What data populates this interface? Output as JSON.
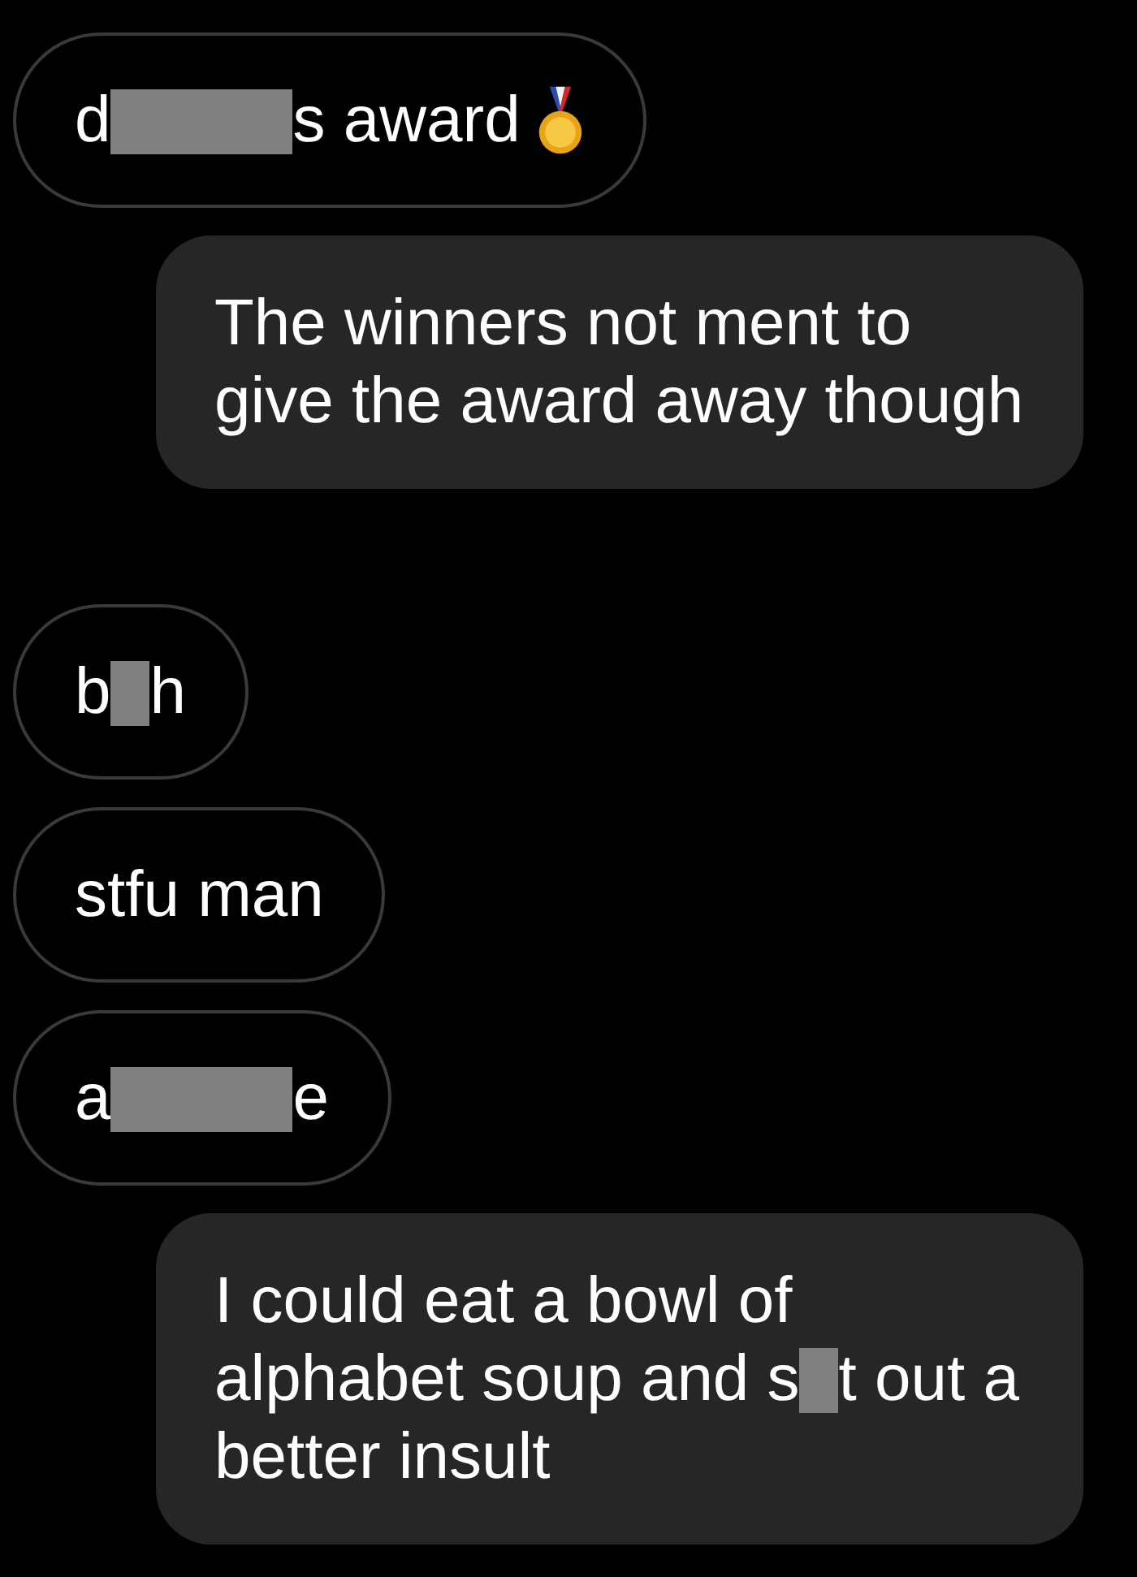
{
  "messages": [
    {
      "kind": "incoming",
      "has_icon": true,
      "segments": [
        {
          "kind": "text",
          "text": "d"
        },
        {
          "kind": "redacted-long"
        },
        {
          "kind": "text",
          "text": "s award"
        }
      ]
    },
    {
      "kind": "outgoing",
      "has_icon": false,
      "segments": [
        {
          "kind": "text",
          "text": "The winners not ment to give the award away though"
        }
      ]
    },
    {
      "kind": "incoming",
      "has_icon": false,
      "segments": [
        {
          "kind": "text",
          "text": "b"
        },
        {
          "kind": "redacted-short"
        },
        {
          "kind": "text",
          "text": "h"
        }
      ]
    },
    {
      "kind": "incoming",
      "has_icon": false,
      "segments": [
        {
          "kind": "text",
          "text": "stfu man"
        }
      ]
    },
    {
      "kind": "incoming",
      "has_icon": false,
      "segments": [
        {
          "kind": "text",
          "text": "a"
        },
        {
          "kind": "redacted-long"
        },
        {
          "kind": "text",
          "text": "e"
        }
      ]
    },
    {
      "kind": "outgoing",
      "has_icon": false,
      "segments": [
        {
          "kind": "text",
          "text": "I could eat a bowl of alphabet soup and s"
        },
        {
          "kind": "redacted-short"
        },
        {
          "kind": "text",
          "text": "t out a better insult"
        }
      ]
    }
  ]
}
